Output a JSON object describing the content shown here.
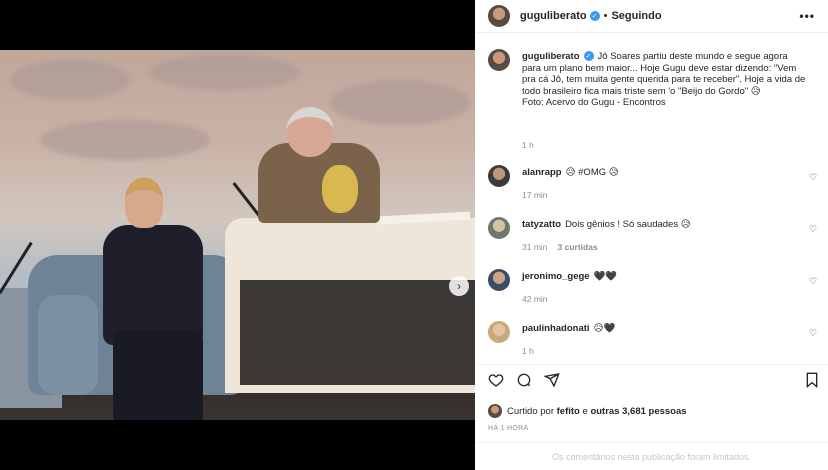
{
  "header": {
    "username": "guguliberato",
    "follow_label": "Seguindo",
    "separator": "•",
    "more_icon": "more-horizontal-icon"
  },
  "caption": {
    "username": "guguliberato",
    "text": "Jô Soares partiu deste mundo e segue agora para um plano bem maior... Hoje Gugu deve estar dizendo: \"Vem pra cá Jô, tem muita gente querida para te receber\". Hoje a vida de todo brasileiro fica mais triste sem 'o \"Beijo do Gordo\" 😥",
    "credit": "Foto: Acervo do Gugu - Encontros",
    "time": "1 h"
  },
  "comments": [
    {
      "username": "alanrapp",
      "text": "😥 #OMG 😥",
      "time": "17 min",
      "replies": ""
    },
    {
      "username": "tatyzatto",
      "text": "Dois gênios ! Só saudades 😥",
      "time": "31 min",
      "replies": "3 curtidas"
    },
    {
      "username": "jeronimo_gege",
      "text": "🖤🖤",
      "time": "42 min",
      "replies": ""
    },
    {
      "username": "paulinhadonati",
      "text": "😥🖤",
      "time": "1 h",
      "replies": ""
    }
  ],
  "actions": {
    "like_icon": "heart-icon",
    "comment_icon": "comment-icon",
    "share_icon": "share-icon",
    "save_icon": "bookmark-icon"
  },
  "likes": {
    "prefix": "Curtido por",
    "user": "fefito",
    "middle": "e",
    "others": "outras 3,681 pessoas"
  },
  "timestamp": "HÁ 1 HORA",
  "limited_notice": "Os comentários nesta publicação foram limitados.",
  "carousel": {
    "current": 1,
    "total": 2
  }
}
